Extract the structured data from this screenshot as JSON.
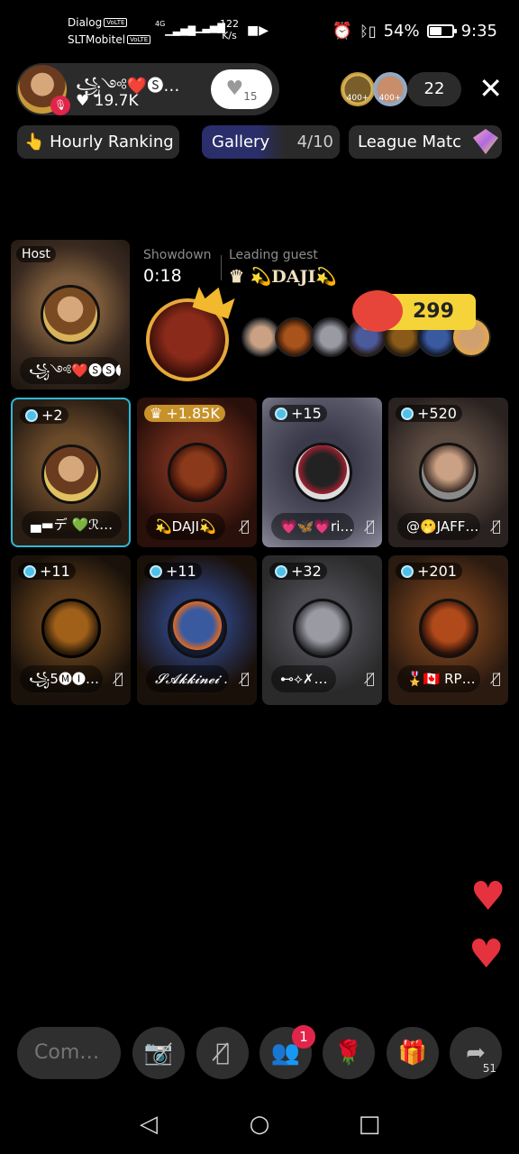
{
  "status": {
    "carrier1": "Dialog",
    "carrier2": "SLTMobitel",
    "volte": "VoLTE",
    "net_type": "4G",
    "net_speed_value": "122",
    "net_speed_unit": "K/s",
    "battery": "54%",
    "time": "9:35"
  },
  "host": {
    "name": "꧁༺❤️🅢…",
    "likes": "♥ 19.7K",
    "like_button_count": "15",
    "viewer_badge_1": "400+",
    "viewer_badge_2": "400+",
    "viewer_count": "22"
  },
  "chips": {
    "ranking": "👆 Hourly Ranking",
    "gallery": "Gallery",
    "gallery_progress": "4/10",
    "league": "League Matc"
  },
  "host_card": {
    "tag": "Host",
    "name": "꧁༺❤️🅢🅢🅣…"
  },
  "showdown": {
    "label": "Showdown",
    "timer": "0:18",
    "leading_label": "Leading guest",
    "leading_name": "♛ 💫DAJI💫",
    "score": "299"
  },
  "guests": [
    {
      "score": "+2",
      "name": "▄▬デ 💚ℛ…",
      "crown": false
    },
    {
      "score": "+1.85K",
      "name": "💫DAJI💫",
      "crown": true
    },
    {
      "score": "+15",
      "name": "💗🦋💗ri…",
      "crown": false
    },
    {
      "score": "+520",
      "name": "@🫢JAFF…",
      "crown": false
    },
    {
      "score": "+11",
      "name": "꧁5🅜🅘…",
      "crown": false
    },
    {
      "score": "+11",
      "name": "𝓢𝓐𝓴𝓴𝓲𝓷𝓮𝓲 …",
      "crown": false
    },
    {
      "score": "+32",
      "name": "⊷⟡✗…",
      "crown": false
    },
    {
      "score": "+201",
      "name": "🎖️🇨🇦 RP…",
      "crown": false
    }
  ],
  "bottom": {
    "comment_placeholder": "Com…",
    "requests_badge": "1",
    "share_count": "51"
  },
  "icons": {
    "close": "close-icon",
    "video_off": "video-off-icon",
    "mic_off": "mic-off-icon",
    "requests": "users-icon",
    "rose": "rose-icon",
    "gift": "gift-icon",
    "share": "share-icon"
  }
}
